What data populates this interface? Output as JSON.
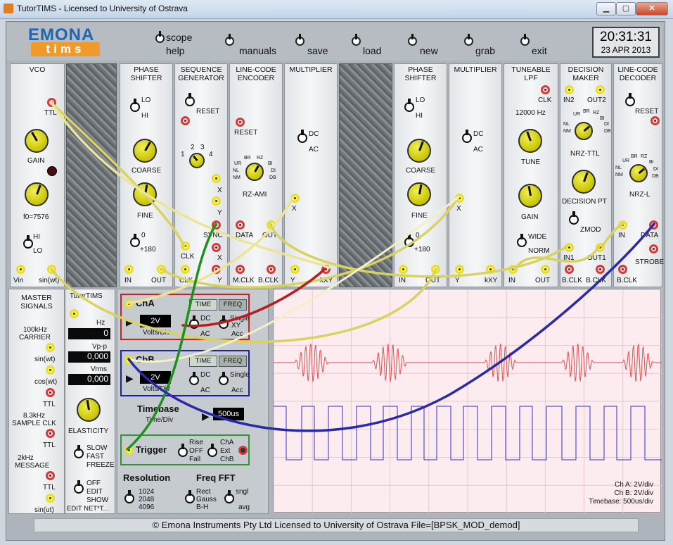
{
  "window": {
    "title": "TutorTIMS - Licensed to University of Ostrava",
    "minimize": "▁",
    "maximize": "▢",
    "close": "✕"
  },
  "logo": {
    "line1": "EMONA",
    "line2": "tims"
  },
  "menu": {
    "scope": "scope",
    "help": "help",
    "manuals": "manuals",
    "save": "save",
    "load": "load",
    "new": "new",
    "grab": "grab",
    "exit": "exit"
  },
  "clock": {
    "time": "20:31:31",
    "date": "23 APR 2013"
  },
  "modules": {
    "vco": {
      "title": "VCO",
      "ttl": "TTL",
      "gain": "GAIN",
      "f0": "f0=7576",
      "hi": "HI",
      "lo": "LO",
      "vin": "Vin",
      "sin": "sin(wt)"
    },
    "phase1": {
      "title1": "PHASE",
      "title2": "SHIFTER",
      "lo": "LO",
      "hi": "HI",
      "coarse": "COARSE",
      "fine": "FINE",
      "zero": "0",
      "p180": "+180",
      "in": "IN",
      "out": "OUT"
    },
    "seqgen": {
      "title1": "SEQUENCE",
      "title2": "GENERATOR",
      "reset": "RESET",
      "n1": "1",
      "n2": "2",
      "n3": "3",
      "n4": "4",
      "x": "X",
      "y": "Y",
      "sync": "SYNC",
      "x2": "X",
      "y2": "Y",
      "clk": "CLK",
      "clk2": "CLK"
    },
    "lineenc": {
      "title1": "LINE-CODE",
      "title2": "ENCODER",
      "reset": "RESET",
      "br": "BR",
      "rz": "RZ",
      "ur": "UR",
      "bi": "BI",
      "nl": "NL",
      "di": "DI",
      "nm": "NM",
      "db": "DB",
      "code": "RZ-AMI",
      "data": "DATA",
      "out": "OUT",
      "mclk": "M.CLK",
      "bclk": "B.CLK"
    },
    "mult1": {
      "title": "MULTIPLIER",
      "dc": "DC",
      "ac": "AC",
      "x": "X",
      "y": "Y",
      "kxy": "kXY"
    },
    "phase2": {
      "title1": "PHASE",
      "title2": "SHIFTER",
      "lo": "LO",
      "hi": "HI",
      "coarse": "COARSE",
      "fine": "FINE",
      "zero": "0",
      "p180": "+180",
      "in": "IN",
      "out": "OUT"
    },
    "mult2": {
      "title": "MULTIPLIER",
      "dc": "DC",
      "ac": "AC",
      "x": "X",
      "y": "Y",
      "kxy": "kXY"
    },
    "lpf": {
      "title1": "TUNEABLE",
      "title2": "LPF",
      "clk": "CLK",
      "freq": "12000 Hz",
      "tune": "TUNE",
      "gain": "GAIN",
      "wide": "WIDE",
      "norm": "NORM",
      "in": "IN",
      "out": "OUT"
    },
    "decision": {
      "title1": "DECISION",
      "title2": "MAKER",
      "in2": "IN2",
      "out2": "OUT2",
      "code": "NRZ-TTL",
      "dpt": "DECISION PT",
      "zmod": "ZMOD",
      "in1": "IN1",
      "out1": "OUT1",
      "bclk": "B.CLK",
      "bclk2": "B.CLK",
      "ur": "UR",
      "br": "BR",
      "rz": "RZ",
      "bi": "BI",
      "nl": "NL",
      "di": "DI",
      "nm": "NM",
      "db": "DB"
    },
    "linedec": {
      "title1": "LINE-CODE",
      "title2": "DECODER",
      "reset": "RESET",
      "code": "NRZ-L",
      "in": "IN",
      "data": "DATA",
      "strobe": "STROBE",
      "bclk": "B.CLK",
      "ur": "UR",
      "br": "BR",
      "rz": "RZ",
      "bi": "BI",
      "nl": "NL",
      "di": "DI",
      "nm": "NM",
      "db": "DB"
    }
  },
  "master": {
    "title1": "MASTER",
    "title2": "SIGNALS",
    "carrier1": "100kHz",
    "carrier2": "CARRIER",
    "sin": "sin(wt)",
    "cos": "cos(wt)",
    "ttl": "TTL",
    "sample1": "8.3kHz",
    "sample2": "SAMPLE CLK",
    "ttl2": "TTL",
    "msg1": "2kHz",
    "msg2": "MESSAGE",
    "ttl3": "TTL",
    "sin2": "sin(ut)"
  },
  "tutortims": {
    "title": "TutorTIMS",
    "hz_label": "Hz",
    "hz_val": "0",
    "vpp_label": "Vp-p",
    "vpp_val": "0,000",
    "vrms_label": "Vrms",
    "vrms_val": "0,000",
    "elasticity": "ELASTICITY",
    "slow": "SLOW",
    "fast": "FAST",
    "freeze": "FREEZE",
    "off": "OFF",
    "edit": "EDIT",
    "show": "SHOW",
    "editnet": "EDIT NET*T..."
  },
  "scope": {
    "cha": "ChA",
    "chb": "ChB",
    "time": "TIME",
    "freq": "FREQ",
    "cha_volts": "2V",
    "chb_volts": "2V",
    "volts_div": "Volts/Div",
    "dc": "DC",
    "ac": "AC",
    "single": "Single",
    "xy": "XY",
    "acc": "Acc",
    "timebase": "Timebase",
    "time_div": "Time/Div",
    "tb_val": "500us",
    "trigger": "Trigger",
    "rise": "Rise",
    "off": "OFF",
    "fall": "Fall",
    "tcha": "ChA",
    "ext": "Ext",
    "tchb": "ChB",
    "resolution": "Resolution",
    "r1": "1024",
    "r2": "2048",
    "r3": "4096",
    "freqfft": "Freq FFT",
    "rect": "Rect",
    "gauss": "Gauss",
    "bh": "B-H",
    "sngl": "sngl",
    "avg": "avg"
  },
  "screen": {
    "readout_a": "Ch A: 2V/div",
    "readout_b": "Ch B: 2V/div",
    "readout_tb": "Timebase: 500us/div",
    "cha_color": "#e05050",
    "chb_color": "#3030c8"
  },
  "status": {
    "text": "© Emona Instruments Pty Ltd Licensed to University of Ostrava    File=[BPSK_MOD_demod]"
  }
}
